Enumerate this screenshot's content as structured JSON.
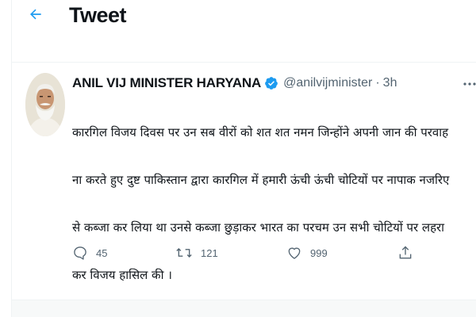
{
  "header": {
    "title": "Tweet",
    "back_icon": "arrow-left-icon"
  },
  "tweet": {
    "author": {
      "display_name": "ANIL VIJ MINISTER HARYANA",
      "handle": "@anilvijminister",
      "verified": true
    },
    "separator": "·",
    "time": "3h",
    "text_lines": [
      "कारगिल विजय दिवस पर उन सब वीरों को शत शत नमन जिन्होंने अपनी जान की परवाह",
      "ना करते हुए दुष्ट पाकिस्तान द्वारा कारगिल में हमारी ऊंची ऊंची चोटियों पर नापाक नजरिए",
      "से कब्जा कर लिया था उनसे कब्जा छुड़ाकर भारत का परचम उन सभी चोटियों पर लहरा",
      "कर विजय हासिल की ।"
    ],
    "actions": {
      "replies": "45",
      "retweets": "121",
      "likes": "999"
    }
  },
  "colors": {
    "accent": "#1d9bf0",
    "text": "#0f1419",
    "muted": "#536471",
    "border": "#eff3f4"
  }
}
